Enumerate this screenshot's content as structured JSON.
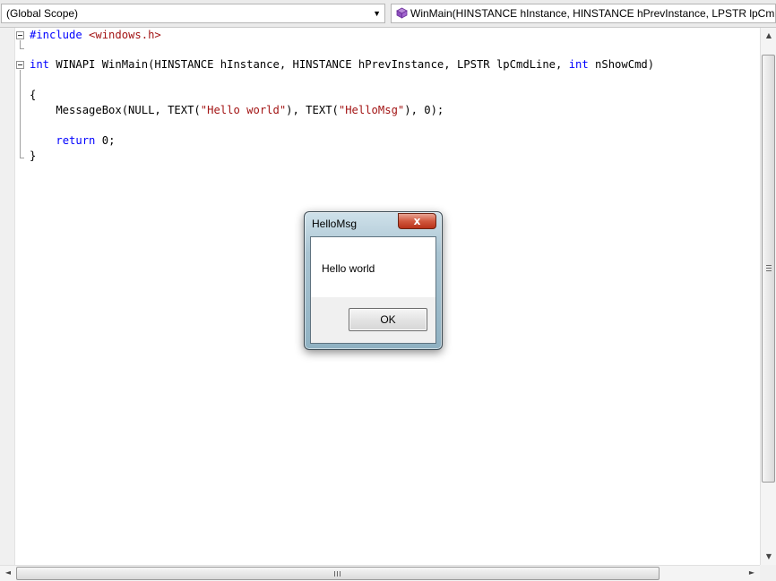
{
  "toolbar": {
    "scope_combo": "(Global Scope)",
    "function_combo": "WinMain(HINSTANCE hInstance, HINSTANCE hPrevInstance, LPSTR lpCm",
    "dropdown_icon": "chevron-down-icon",
    "function_icon": "method-icon"
  },
  "code": {
    "line1": {
      "pp": "#include",
      "str": "<windows.h>"
    },
    "line3": {
      "kw1": "int",
      "mid": " WINAPI WinMain(HINSTANCE hInstance, HINSTANCE hPrevInstance, LPSTR lpCmdLine, ",
      "kw2": "int",
      "end": " nShowCmd)"
    },
    "line5": "{",
    "line6": {
      "a": "    MessageBox(NULL, TEXT(",
      "s1": "\"Hello world\"",
      "b": "), TEXT(",
      "s2": "\"HelloMsg\"",
      "c": "), 0);"
    },
    "line8": {
      "kw": "return",
      "end": " 0;"
    },
    "line9": "}"
  },
  "dialog": {
    "title": "HelloMsg",
    "close_glyph": "x",
    "message": "Hello world",
    "ok_label": "OK"
  },
  "scrollbars": {
    "up_glyph": "▲",
    "down_glyph": "▼",
    "left_glyph": "◄",
    "right_glyph": "►"
  },
  "colors": {
    "keyword": "#0000ff",
    "string": "#a31515",
    "close_button": "#c9442a"
  }
}
